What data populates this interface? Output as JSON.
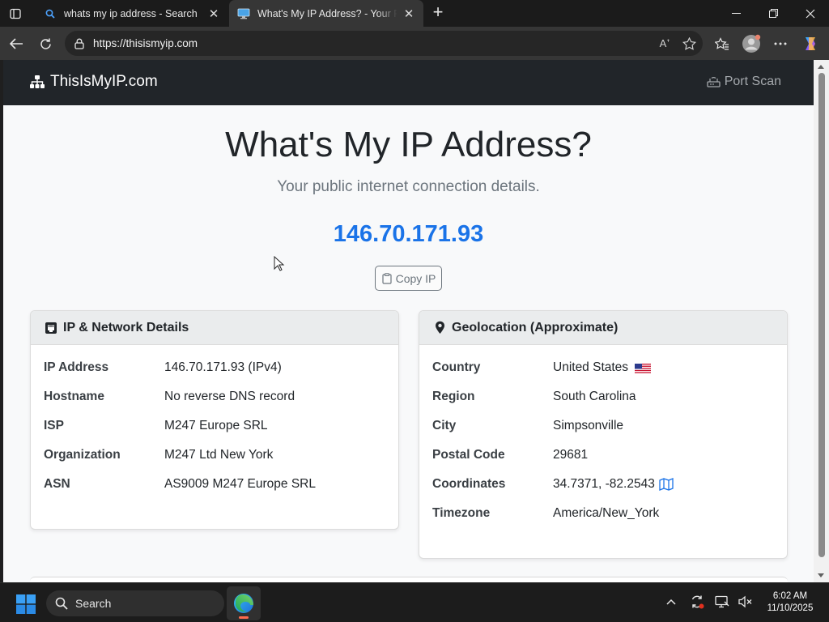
{
  "browser": {
    "tabs": [
      {
        "title": "whats my ip address - Search",
        "icon": "search-icon",
        "active": false
      },
      {
        "title": "What's My IP Address? - Your Public IP",
        "icon": "monitor-icon",
        "active": true
      }
    ],
    "url": "https://thisismyip.com"
  },
  "site": {
    "brand": "ThisIsMyIP.com",
    "nav_link": "Port Scan",
    "heading": "What's My IP Address?",
    "lead": "Your public internet connection details.",
    "ip": "146.70.171.93",
    "copy_button": "Copy IP"
  },
  "network_card": {
    "title": "IP & Network Details",
    "icon": "ethernet-icon",
    "rows": [
      {
        "label": "IP Address",
        "value": "146.70.171.93 (IPv4)"
      },
      {
        "label": "Hostname",
        "value": "No reverse DNS record"
      },
      {
        "label": "ISP",
        "value": "M247 Europe SRL"
      },
      {
        "label": "Organization",
        "value": "M247 Ltd New York"
      },
      {
        "label": "ASN",
        "value": "AS9009 M247 Europe SRL"
      }
    ]
  },
  "geo_card": {
    "title": "Geolocation (Approximate)",
    "icon": "map-pin-icon",
    "rows": [
      {
        "label": "Country",
        "value": "United States"
      },
      {
        "label": "Region",
        "value": "South Carolina"
      },
      {
        "label": "City",
        "value": "Simpsonville"
      },
      {
        "label": "Postal Code",
        "value": "29681"
      },
      {
        "label": "Coordinates",
        "value": "34.7371, -82.2543"
      },
      {
        "label": "Timezone",
        "value": "America/New_York"
      }
    ]
  },
  "taskbar": {
    "search_label": "Search",
    "time": "6:02 AM",
    "date": "11/10/2025"
  },
  "colors": {
    "accent_ip": "#1a73e8",
    "navbar": "#212529",
    "page_bg": "#f8f9fa"
  }
}
